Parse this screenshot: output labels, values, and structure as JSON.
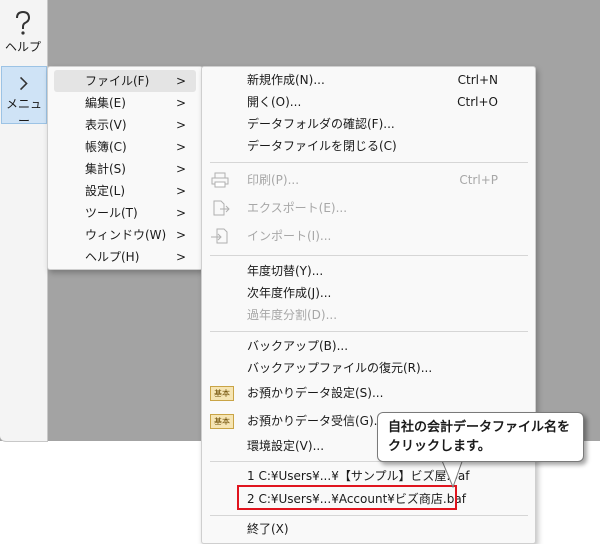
{
  "sidebar": {
    "help_label": "ヘルプ",
    "menu_label": "メニュー"
  },
  "menu1": {
    "items": [
      {
        "label": "ファイル(F)"
      },
      {
        "label": "編集(E)"
      },
      {
        "label": "表示(V)"
      },
      {
        "label": "帳簿(C)"
      },
      {
        "label": "集計(S)"
      },
      {
        "label": "設定(L)"
      },
      {
        "label": "ツール(T)"
      },
      {
        "label": "ウィンドウ(W)"
      },
      {
        "label": "ヘルプ(H)"
      }
    ],
    "arrow": ">"
  },
  "menu2": {
    "new": {
      "label": "新規作成(N)...",
      "key": "Ctrl+N"
    },
    "open": {
      "label": "開く(O)...",
      "key": "Ctrl+O"
    },
    "folder": {
      "label": "データフォルダの確認(F)..."
    },
    "close": {
      "label": "データファイルを閉じる(C)"
    },
    "print": {
      "label": "印刷(P)...",
      "key": "Ctrl+P"
    },
    "export": {
      "label": "エクスポート(E)..."
    },
    "import": {
      "label": "インポート(I)..."
    },
    "year_switch": {
      "label": "年度切替(Y)..."
    },
    "next_year": {
      "label": "次年度作成(J)..."
    },
    "past_year": {
      "label": "過年度分割(D)..."
    },
    "backup": {
      "label": "バックアップ(B)..."
    },
    "restore": {
      "label": "バックアップファイルの復元(R)..."
    },
    "deposit_set": {
      "label": "お預かりデータ設定(S)..."
    },
    "deposit_recv": {
      "label": "お預かりデータ受信(G)..."
    },
    "env": {
      "label": "環境設定(V)..."
    },
    "recent1": {
      "label": "1 C:¥Users¥...¥【サンプル】ビズ屋.baf"
    },
    "recent2": {
      "label": "2 C:¥Users¥...¥Account¥ビズ商店.baf"
    },
    "exit": {
      "label": "終了(X)"
    },
    "badge_text": "基本"
  },
  "callout": {
    "line1": "自社の会計データファイル名を",
    "line2": "クリックします。"
  }
}
